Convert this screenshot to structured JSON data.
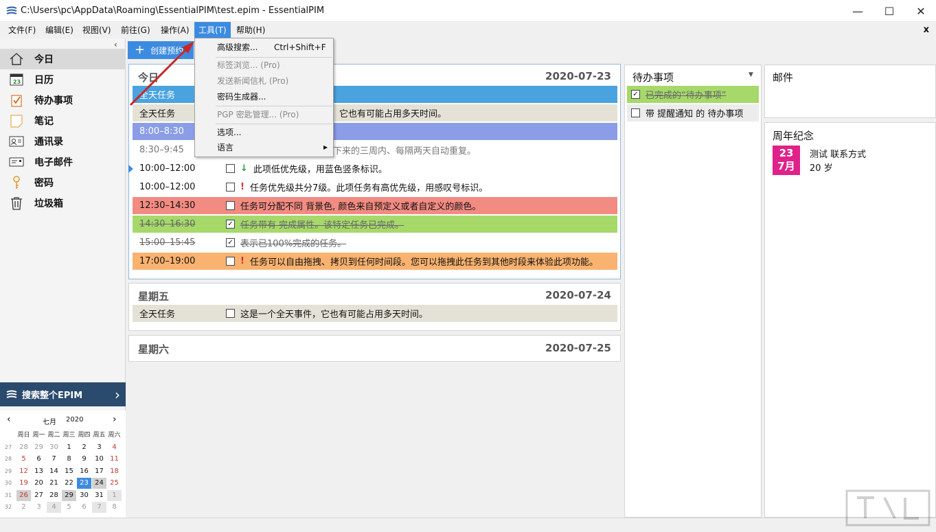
{
  "window": {
    "title": "C:\\Users\\pc\\AppData\\Roaming\\EssentialPIM\\test.epim - EssentialPIM"
  },
  "menubar": {
    "items": [
      "文件(F)",
      "编辑(E)",
      "视图(V)",
      "前往(G)",
      "操作(A)",
      "工具(T)",
      "帮助(H)"
    ],
    "close": "x"
  },
  "tools_menu": {
    "advanced_search": "高级搜索...",
    "advanced_search_shortcut": "Ctrl+Shift+F",
    "tag_browser": "标签浏览... (Pro)",
    "send_newsletter": "发送新闻信札 (Pro)",
    "password_generator": "密码生成器...",
    "pgp_manager": "PGP 密匙管理... (Pro)",
    "options": "选项...",
    "language": "语言"
  },
  "sidebar": {
    "items": [
      {
        "label": "今日",
        "icon": "home-icon"
      },
      {
        "label": "日历",
        "icon": "calendar-icon"
      },
      {
        "label": "待办事项",
        "icon": "todo-icon"
      },
      {
        "label": "笔记",
        "icon": "note-icon"
      },
      {
        "label": "通讯录",
        "icon": "contacts-icon"
      },
      {
        "label": "电子邮件",
        "icon": "email-icon"
      },
      {
        "label": "密码",
        "icon": "key-icon"
      },
      {
        "label": "垃圾箱",
        "icon": "trash-icon"
      }
    ],
    "search_label": "搜索整个EPIM"
  },
  "minical": {
    "month": "七月",
    "year": "2020",
    "weekdays": [
      "周日",
      "周一",
      "周二",
      "周三",
      "周四",
      "周五",
      "周六"
    ],
    "weeks": [
      {
        "wk": "27",
        "days": [
          "28",
          "29",
          "30",
          "1",
          "2",
          "3",
          "4"
        ]
      },
      {
        "wk": "28",
        "days": [
          "5",
          "6",
          "7",
          "8",
          "9",
          "10",
          "11"
        ]
      },
      {
        "wk": "29",
        "days": [
          "12",
          "13",
          "14",
          "15",
          "16",
          "17",
          "18"
        ]
      },
      {
        "wk": "30",
        "days": [
          "19",
          "20",
          "21",
          "22",
          "23",
          "24",
          "25"
        ]
      },
      {
        "wk": "31",
        "days": [
          "26",
          "27",
          "28",
          "29",
          "30",
          "31",
          "1"
        ]
      },
      {
        "wk": "32",
        "days": [
          "2",
          "3",
          "4",
          "5",
          "6",
          "7",
          "8"
        ]
      }
    ]
  },
  "toolbar": {
    "new_label": "创建预约"
  },
  "today": {
    "label": "今日",
    "date": "2020-07-23",
    "rows": [
      {
        "time": "全天任务",
        "text": "",
        "bg": "#4aa3df"
      },
      {
        "time": "全天任务",
        "text": "它也有可能占用多天时间。",
        "bg": "#e4e2d6"
      },
      {
        "time": "8:00–8:30",
        "text": "",
        "bg": "#8b9de6"
      },
      {
        "time": "8:30–9:45",
        "text": "性的任务。它被设置为在接下来的三周内、每隔两天自动重复。",
        "bg": "#ffffff"
      },
      {
        "time": "10:00–12:00",
        "text": "此项低优先级，用蓝色竖条标识。",
        "bg": "#ffffff"
      },
      {
        "time": "10:00–12:00",
        "text": "任务优先级共分7级。此项任务有高优先级，用感叹号标识。",
        "bg": "#ffffff"
      },
      {
        "time": "12:30–14:30",
        "text": "任务可分配不同 背景色, 颜色来自预定义或者自定义的颜色。",
        "bg": "#f28b82"
      },
      {
        "time": "14:30–16:30",
        "text": "任务带有 完成属性。该特定任务已完成。",
        "bg": "#a6d96a"
      },
      {
        "time": "15:00–15:45",
        "text": "表示已100%完成的任务。",
        "bg": "#ffffff"
      },
      {
        "time": "17:00–19:00",
        "text": "任务可以自由拖拽、拷贝到任何时间段。您可以拖拽此任务到其他时段来体验此项功能。",
        "bg": "#f9b26f"
      }
    ]
  },
  "friday": {
    "label": "星期五",
    "date": "2020-07-24",
    "row_time": "全天任务",
    "row_text": "这是一个全天事件，它也有可能占用多天时间。"
  },
  "saturday": {
    "label": "星期六",
    "date": "2020-07-25"
  },
  "todo": {
    "title": "待办事项",
    "items": [
      {
        "text": "已完成的“待办事项”",
        "done": true,
        "bg": "#a6d96a"
      },
      {
        "text": "带 提醒通知 的 待办事项",
        "done": false,
        "bg": "#ececec"
      }
    ]
  },
  "mail": {
    "title": "邮件"
  },
  "anniversary": {
    "title": "周年纪念",
    "day": "23",
    "month": "7月",
    "name": "测试 联系方式",
    "age": "20 岁",
    "badge_color": "#e0218a"
  },
  "colors": {
    "accent": "#3d8be0",
    "sidebar_search": "#2a4a6e"
  }
}
